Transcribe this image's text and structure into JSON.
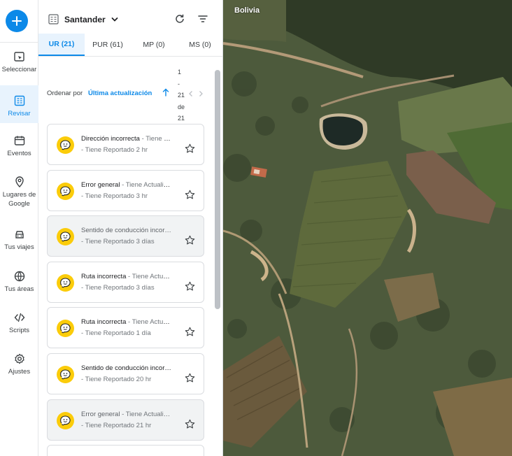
{
  "rail": {
    "add_icon": "plus-icon",
    "items": [
      {
        "label": "Seleccionar",
        "icon": "select-icon"
      },
      {
        "label": "Revisar",
        "icon": "review-icon",
        "active": true
      },
      {
        "label": "Eventos",
        "icon": "calendar-icon"
      },
      {
        "label": "Lugares de Google",
        "line1": "Lugares de",
        "line2": "Google",
        "icon": "pin-icon"
      },
      {
        "label": "Tus viajes",
        "icon": "car-icon"
      },
      {
        "label": "Tus áreas",
        "icon": "globe-icon"
      },
      {
        "label": "Scripts",
        "icon": "code-icon"
      },
      {
        "label": "Ajustes",
        "icon": "gear-icon"
      }
    ]
  },
  "header": {
    "area_name": "Santander"
  },
  "tabs": [
    {
      "label": "UR (21)",
      "active": true
    },
    {
      "label": "PUR (61)"
    },
    {
      "label": "MP (0)"
    },
    {
      "label": "MS (0)"
    }
  ],
  "sort": {
    "label": "Ordenar por",
    "value": "Última actualización",
    "pager": [
      "1",
      "-",
      "21",
      "de",
      "21"
    ]
  },
  "reports": [
    {
      "title": "Dirección incorrecta",
      "suffix": " - Tiene Reportado...",
      "status": "- Tiene Reportado 2 hr",
      "read": false
    },
    {
      "title": "Error general",
      "suffix": " - Tiene Actualizado...",
      "status": "- Tiene Reportado 3 hr",
      "read": false
    },
    {
      "title": "Sentido de conducción incorrecto",
      "suffix": "",
      "status": "- Tiene Reportado 3 días",
      "read": true
    },
    {
      "title": "Ruta incorrecta",
      "suffix": " - Tiene Actualizado...",
      "status": "- Tiene Reportado 3 días",
      "read": false
    },
    {
      "title": "Ruta incorrecta",
      "suffix": " - Tiene Actualizado...",
      "status": "- Tiene Reportado 1 día",
      "read": false
    },
    {
      "title": "Sentido de conducción incorrecto",
      "suffix": "",
      "status": "- Tiene Reportado 20 hr",
      "read": false
    },
    {
      "title": "Error general",
      "suffix": " - Tiene Actualizado...",
      "status": "- Tiene Reportado 21 hr",
      "read": true
    }
  ],
  "map": {
    "country_label": "Bolivia"
  },
  "colors": {
    "accent": "#0c89e8",
    "waze_yellow": "#fbcc0a"
  }
}
